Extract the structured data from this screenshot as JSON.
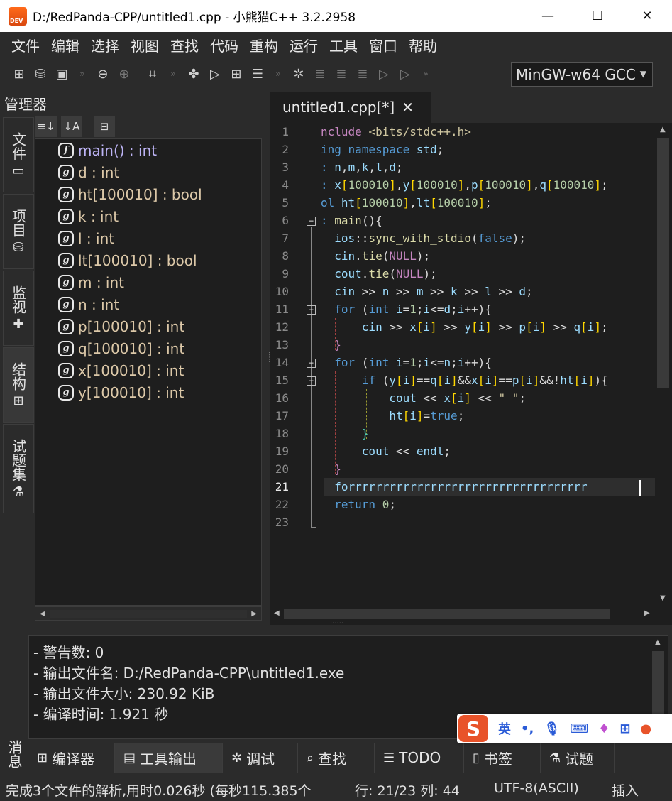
{
  "window": {
    "title": "D:/RedPanda-CPP/untitled1.cpp  - 小熊猫C++ 3.2.2958",
    "logo_text": "DEV",
    "minimize": "—",
    "maximize": "☐",
    "close": "✕"
  },
  "menu": [
    "文件",
    "编辑",
    "选择",
    "视图",
    "查找",
    "代码",
    "重构",
    "运行",
    "工具",
    "窗口",
    "帮助"
  ],
  "toolbar": {
    "compiler": "MinGW-w64 GCC",
    "more": "»"
  },
  "left_panel": {
    "title": "管理器",
    "side_tabs": [
      {
        "label": "文件",
        "icon": "file-icon"
      },
      {
        "label": "项目",
        "icon": "project-icon"
      },
      {
        "label": "监视",
        "icon": "watch-icon"
      },
      {
        "label": "结构",
        "icon": "structure-icon"
      },
      {
        "label": "试题集",
        "icon": "problemset-icon"
      }
    ],
    "tree": [
      {
        "kind": "f",
        "label": "main() : int",
        "type": "function"
      },
      {
        "kind": "g",
        "label": "d : int",
        "type": "global"
      },
      {
        "kind": "g",
        "label": "ht[100010] : bool",
        "type": "global"
      },
      {
        "kind": "g",
        "label": "k : int",
        "type": "global"
      },
      {
        "kind": "g",
        "label": "l : int",
        "type": "global"
      },
      {
        "kind": "g",
        "label": "lt[100010] : bool",
        "type": "global"
      },
      {
        "kind": "g",
        "label": "m : int",
        "type": "global"
      },
      {
        "kind": "g",
        "label": "n : int",
        "type": "global"
      },
      {
        "kind": "g",
        "label": "p[100010] : int",
        "type": "global"
      },
      {
        "kind": "g",
        "label": "q[100010] : int",
        "type": "global"
      },
      {
        "kind": "g",
        "label": "x[100010] : int",
        "type": "global"
      },
      {
        "kind": "g",
        "label": "y[100010] : int",
        "type": "global"
      }
    ]
  },
  "editor": {
    "tab_label": "untitled1.cpp[*]",
    "tab_close": "✕",
    "current_line": 21,
    "line_numbers": [
      "1",
      "2",
      "3",
      "4",
      "5",
      "6",
      "7",
      "8",
      "9",
      "10",
      "11",
      "12",
      "13",
      "14",
      "15",
      "16",
      "17",
      "18",
      "19",
      "20",
      "21",
      "22",
      "23"
    ]
  },
  "output": {
    "lines": [
      "- 警告数: 0",
      "- 输出文件名: D:/RedPanda-CPP\\untitled1.exe",
      "- 输出文件大小: 230.92 KiB",
      "- 编译时间: 1.921 秒"
    ],
    "side_label": "消息"
  },
  "bottom_tabs": [
    {
      "label": "编译器",
      "icon": "⊞"
    },
    {
      "label": "工具输出",
      "icon": "▤"
    },
    {
      "label": "调试",
      "icon": "✲"
    },
    {
      "label": "查找",
      "icon": "⌕"
    },
    {
      "label": "TODO",
      "icon": "☰"
    },
    {
      "label": "书签",
      "icon": "▯"
    },
    {
      "label": "试题",
      "icon": "⚗"
    }
  ],
  "ime": {
    "logo": "S",
    "lang": "英",
    "punct": "•,"
  },
  "status": {
    "parse": "完成3个文件的解析,用时0.026秒 (每秒115.385个",
    "position": "行: 21/23 列: 44",
    "encoding": "UTF-8(ASCII)",
    "mode": "插入"
  }
}
